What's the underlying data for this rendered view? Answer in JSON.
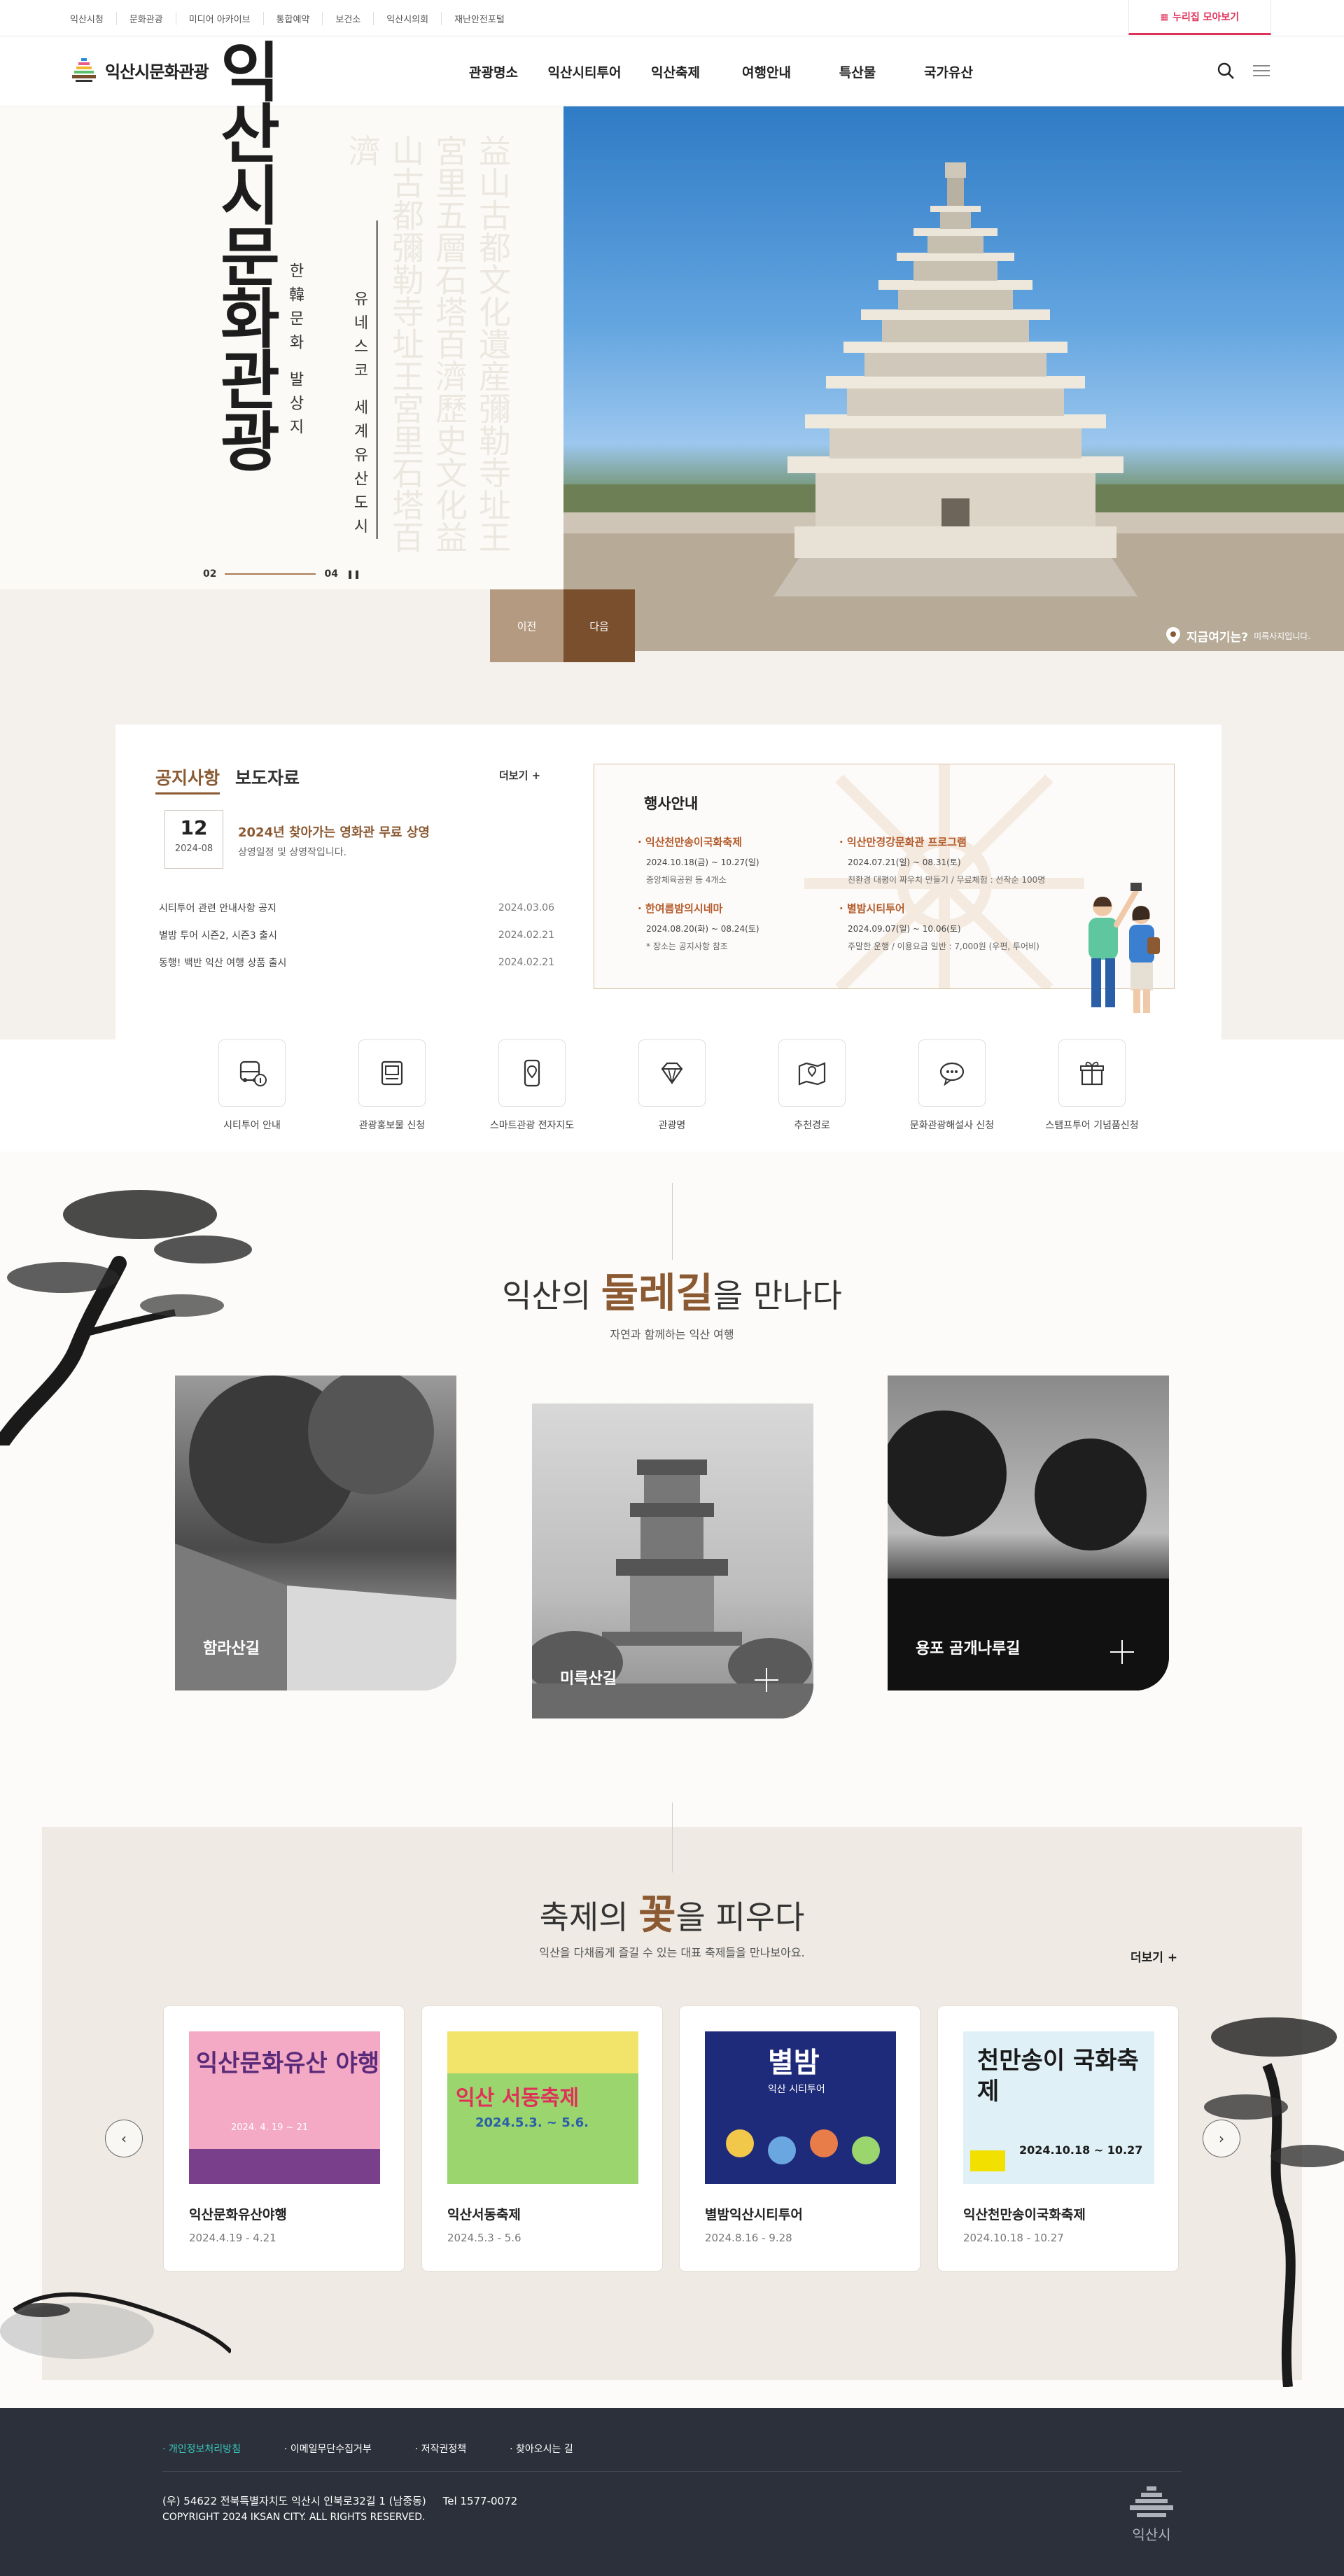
{
  "utility": {
    "links": [
      "익산시청",
      "문화관광",
      "미디어 아카이브",
      "통합예약",
      "보건소",
      "익산시의회",
      "재난안전포털"
    ],
    "nuri_label": "누리집 모아보기"
  },
  "header": {
    "logo_text": "익산시문화관광",
    "menu": [
      "관광명소",
      "익산시티투어",
      "익산축제",
      "여행안내",
      "특산물",
      "국가유산"
    ]
  },
  "hero": {
    "title": "익산시문화관광",
    "sub1": "한韓문화 발상지",
    "sub2": "유네스코 세계유산도시",
    "page_current": "02",
    "page_total": "04",
    "prev_label": "이전",
    "next_label": "다음",
    "location_question": "지금여기는?",
    "location_answer": "미륵사지입니다."
  },
  "notice": {
    "tab_active": "공지사항",
    "tab_other": "보도자료",
    "more_label": "더보기",
    "featured": {
      "day": "12",
      "ym": "2024-08",
      "title": "2024년 찾아가는 영화관 무료 상영",
      "summary": "상영일정 및 상영작입니다."
    },
    "list": [
      {
        "title": "시티투어 관련 안내사항 공지",
        "date": "2024.03.06"
      },
      {
        "title": "별밤 투어 시즌2, 시즌3 출시",
        "date": "2024.02.21"
      },
      {
        "title": "동행! 백반 익산 여행 상품 출시",
        "date": "2024.02.21"
      }
    ]
  },
  "events": {
    "title": "행사안내",
    "items": [
      {
        "title": "익산천만송이국화축제",
        "date": "2024.10.18(금) ~ 10.27(일)",
        "place": "중앙체육공원 등 4개소"
      },
      {
        "title": "익산만경강문화관 프로그램",
        "date": "2024.07.21(일) ~ 08.31(토)",
        "place": "친환경 대평이 짜우치 만들기 / 무료체험 : 선착순 100명"
      },
      {
        "title": "한여름밤의시네마",
        "date": "2024.08.20(화) ~ 08.24(토)",
        "place": "* 장소는 공지사항 참조"
      },
      {
        "title": "별밤시티투어",
        "date": "2024.09.07(일) ~ 10.06(토)",
        "place": "주말한 운행 / 이용요금 일반 : 7,000원 (우편, 투어비)"
      }
    ]
  },
  "quick_menu": [
    {
      "label": "시티투어 안내",
      "icon": "bus-info-icon"
    },
    {
      "label": "관광홍보물 신청",
      "icon": "brochure-icon"
    },
    {
      "label": "스마트관광 전자지도",
      "icon": "smart-map-icon"
    },
    {
      "label": "관광명",
      "icon": "gem-icon"
    },
    {
      "label": "추천경로",
      "icon": "route-map-icon"
    },
    {
      "label": "문화관광해설사 신청",
      "icon": "chat-guide-icon"
    },
    {
      "label": "스탬프투어 기념품신청",
      "icon": "gift-icon"
    }
  ],
  "dulle": {
    "title_pre": "익산의",
    "title_hl": "둘레길",
    "title_post": "을 만나다",
    "subtitle": "자연과 함께하는 익산 여행",
    "cards": [
      "함라산길",
      "미륵산길",
      "용포 곰개나루길"
    ]
  },
  "festival": {
    "title_pre": "축제의",
    "title_hl": "꽃",
    "title_post": "을 피우다",
    "subtitle": "익산을 다채롭게 즐길 수 있는 대표 축제들을 만나보아요.",
    "more_label": "더보기",
    "cards": [
      {
        "name": "익산문화유산야행",
        "date": "2024.4.19 - 4.21",
        "poster_text": "익산문화유산 야행",
        "poster_date": "2024. 4. 19 ~ 21"
      },
      {
        "name": "익산서동축제",
        "date": "2024.5.3 - 5.6",
        "poster_text": "익산 서동축제",
        "poster_date": "2024.5.3. ~ 5.6."
      },
      {
        "name": "별밤익산시티투어",
        "date": "2024.8.16 - 9.28",
        "poster_text": "별밤",
        "poster_date": "익산 시티투어"
      },
      {
        "name": "익산천만송이국화축제",
        "date": "2024.10.18 - 10.27",
        "poster_text": "천만송이 국화축제",
        "poster_date": "2024.10.18 ~ 10.27"
      }
    ]
  },
  "footer": {
    "links": [
      "개인정보처리방침",
      "이메일무단수집거부",
      "저작권정책",
      "찾아오시는 길"
    ],
    "address": "(우) 54622 전북특별자치도 익산시 인북로32길 1 (남중동)",
    "tel": "Tel 1577-0072",
    "copyright": "COPYRIGHT 2024 IKSAN CITY. ALL RIGHTS RESERVED.",
    "logo_text": "익산시"
  },
  "colors": {
    "accent_brown": "#8b5a33",
    "nuri_red": "#e0305a",
    "footer_bg": "#2c303a",
    "footer_active": "#37c7b9"
  }
}
